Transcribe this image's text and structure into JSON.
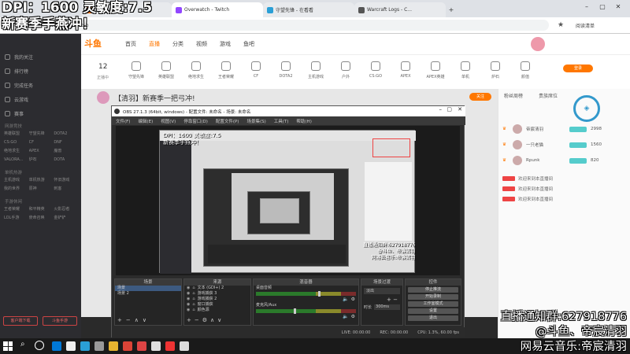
{
  "overlay": {
    "dpi_line": "DPI：1600 灵敏度:7.5",
    "season_line": "新赛季手燕冲！",
    "group_line": "直播通知群:627918776",
    "douyu_line": "@斗鱼、帝宸清羽",
    "music_line": "网易云音乐:帝宸清羽"
  },
  "browser": {
    "tabs": [
      "斗鱼直播",
      "Overwatch - Twitch",
      "守望先锋 - 在看看",
      "Warcraft Logs - C..."
    ],
    "tab_prefix": "ws",
    "url": "www.douyu.com",
    "bookmark_label": "阅读清单"
  },
  "site": {
    "logo": "斗鱼",
    "nav": [
      "首页",
      "直播",
      "分类",
      "视频",
      "游戏",
      "鱼吧"
    ],
    "live_count": "12",
    "live_count_label": "正播中",
    "categories": [
      "守望先锋",
      "英雄联盟",
      "绝地求生",
      "王者荣耀",
      "CF",
      "DOTA2",
      "主机游戏",
      "户外",
      "CS:GO",
      "APEX",
      "APEX英雄",
      "单机",
      "炉石",
      "颜值"
    ],
    "stream_title": "【清羽】新赛季一把弓冲!",
    "follow_button": "关注",
    "sidebar": [
      {
        "label": "我的关注",
        "icon": "heart-icon"
      },
      {
        "label": "排行榜",
        "icon": "rank-icon"
      },
      {
        "label": "完成任务",
        "icon": "task-icon"
      },
      {
        "label": "云游戏",
        "icon": "cloud-icon"
      },
      {
        "label": "赛事",
        "icon": "trophy-icon"
      }
    ],
    "sidebar_section1": "网游竞技",
    "sidebar_grid1": [
      "英雄联盟",
      "守望先锋",
      "DOTA2",
      "CS:GO",
      "CF",
      "DNF",
      "绝地求生",
      "APEX",
      "魔兽",
      "VALORA...",
      "炉石",
      "DOTA"
    ],
    "sidebar_section2": "单机热游",
    "sidebar_grid2": [
      "主机游戏",
      "单机热游",
      "怀旧游戏",
      "我的世界",
      "原神",
      "刺客"
    ],
    "sidebar_section3": "手游休闲",
    "sidebar_grid3": [
      "王者荣耀",
      "和平精英",
      "火影忍者",
      "LOL手游",
      "使命召唤",
      "金铲铲"
    ],
    "sidebar_bottom": [
      "客户端下载",
      "斗鱼手游"
    ],
    "rank_tabs": [
      "粉丝周榜",
      "贵族席位"
    ],
    "ranks": [
      {
        "name": "帝宸清羽",
        "value": "2998"
      },
      {
        "name": "一只老猫",
        "value": "1560"
      },
      {
        "name": "Rpunk",
        "value": "820"
      }
    ],
    "chat": [
      "欢迎来到本直播间",
      "欢迎来到本直播间",
      "欢迎来到本直播间"
    ],
    "login_button": "登录"
  },
  "obs": {
    "title": "OBS 27.1.3 (64bit, windows) - 配置文件: 未命名 - 场景: 未命名",
    "menu": [
      "文件(F)",
      "编辑(E)",
      "视图(V)",
      "停靠窗口(D)",
      "配置文件(P)",
      "场景集(S)",
      "工具(T)",
      "帮助(H)"
    ],
    "docks": {
      "scenes": {
        "title": "场景",
        "items": [
          "场景",
          "场景 2"
        ]
      },
      "sources": {
        "title": "来源",
        "items": [
          "文本 (GDI+) 2",
          "游戏捕获 3",
          "游戏捕获 2",
          "窗口捕获",
          "颜色源"
        ]
      },
      "mixer": {
        "title": "混音器",
        "items": [
          "桌面音频",
          "麦克风/Aux"
        ],
        "levels": [
          0.62,
          0.38
        ]
      },
      "transitions": {
        "title": "场景过渡",
        "selected": "淡出",
        "duration_label": "时长",
        "duration": "300ms"
      },
      "controls": {
        "title": "控件",
        "buttons": [
          "停止推流",
          "开始录制",
          "工作室模式",
          "设置",
          "退出"
        ]
      }
    },
    "status": {
      "live_label": "LIVE:",
      "live_time": "00:00:00",
      "rec_label": "REC:",
      "rec_time": "00:00:00",
      "cpu": "CPU: 1.3%, 60.00 fps"
    }
  },
  "taskbar": {
    "colors": [
      "#0078d7",
      "#eeeeee",
      "#2a9fd6",
      "#999999",
      "#e8b430",
      "#db4437",
      "#d44",
      "#e0e0e0",
      "#e33",
      "#ddd"
    ]
  }
}
